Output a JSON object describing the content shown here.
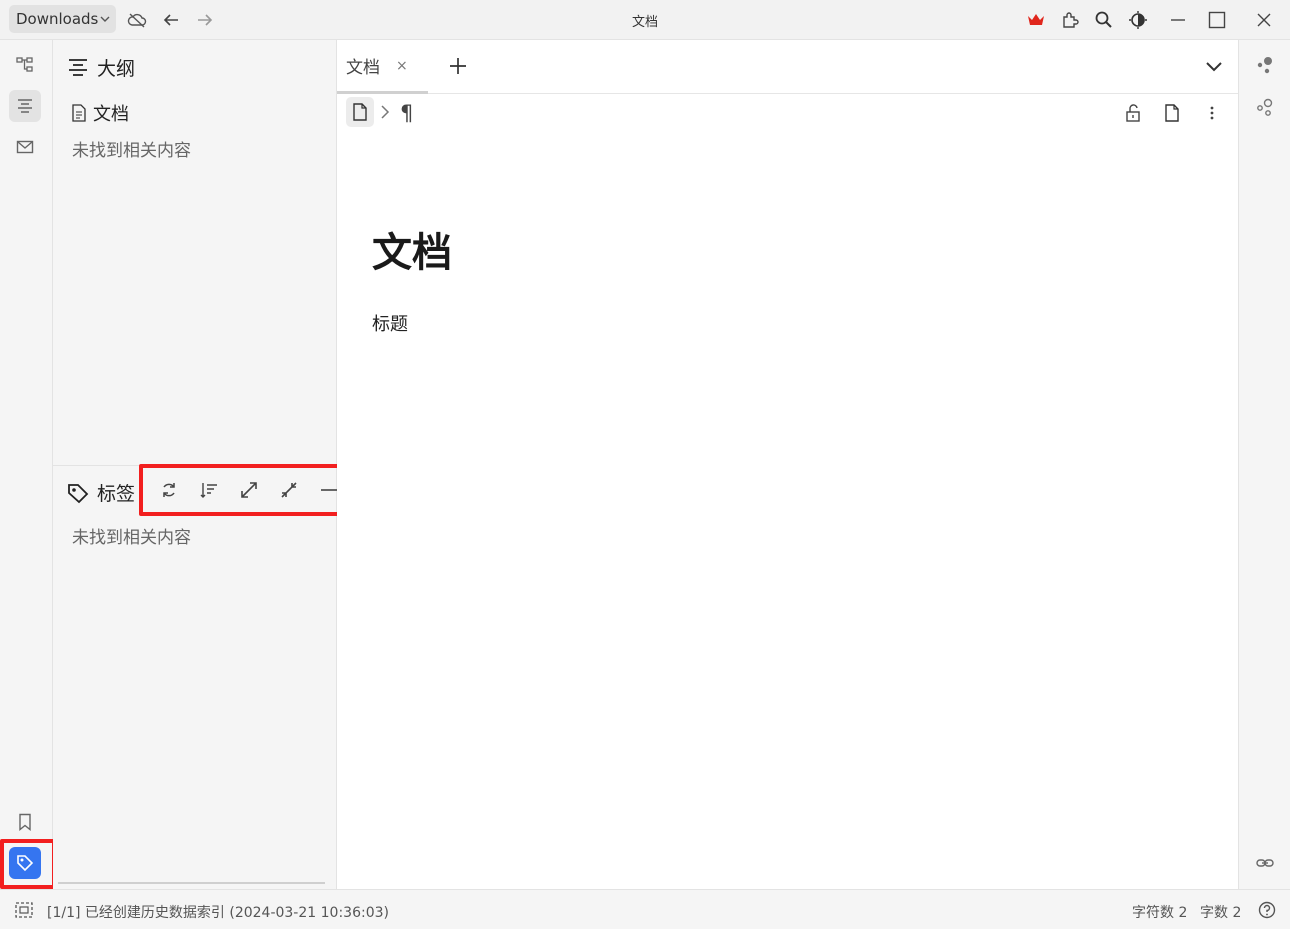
{
  "titlebar": {
    "workspace": "Downloads",
    "window_title": "文档",
    "icons": [
      "cloud-off-icon",
      "back-arrow-icon",
      "forward-arrow-icon",
      "crown-icon",
      "plugin-icon",
      "search-icon",
      "theme-icon",
      "minimize-icon",
      "maximize-icon",
      "close-icon"
    ],
    "crown_color": "#e0261c"
  },
  "left_dock": {
    "items": [
      "file-tree-icon",
      "outline-icon",
      "inbox-icon",
      "bookmark-icon",
      "tag-icon"
    ],
    "active_accent": "#3575f0"
  },
  "outline_panel": {
    "title": "大纲",
    "doc_item": "文档",
    "empty_text": "未找到相关内容"
  },
  "tag_panel": {
    "title": "标签",
    "empty_text": "未找到相关内容",
    "tools": [
      "refresh-icon",
      "sort-icon",
      "expand-icon",
      "collapse-icon",
      "minimize-panel-icon"
    ]
  },
  "editor": {
    "tab_label": "文档",
    "tab_close": "×",
    "breadcrumb_para": "¶",
    "doc_title": "文档",
    "doc_body": "标题"
  },
  "statusbar": {
    "message": "[1/1] 已经创建历史数据索引 (2024-03-21 10:36:03)",
    "char_count": "字符数 2",
    "word_count": "字数 2"
  },
  "highlight_color": "#f21f1f"
}
